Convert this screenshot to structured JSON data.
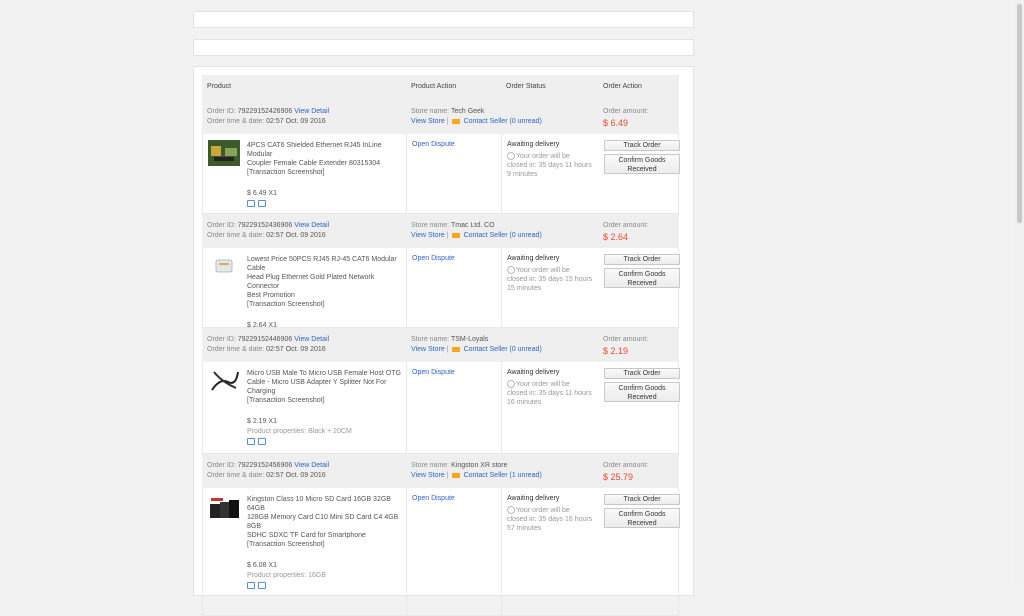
{
  "header": {
    "product": "Product",
    "product_action": "Product Action",
    "order_status": "Order Status",
    "order_action": "Order Action"
  },
  "labels": {
    "order_id": "Order ID:",
    "order_time": "Order time & date:",
    "view_detail": "View Detail",
    "store_name": "Store name:",
    "view_store": "View Store",
    "separator": "|",
    "contact_seller": "Contact Seller",
    "order_amount": "Order amount:",
    "transaction_screenshot": "[Transaction Screenshot]",
    "open_dispute": "Open Dispute",
    "awaiting": "Awaiting delivery",
    "track_order": "Track Order",
    "confirm_line1": "Confirm Goods",
    "confirm_line2": "Received"
  },
  "orders": [
    {
      "id": "79229152426906",
      "time": "02:57 Oct. 09 2016",
      "store": "Tech Geek",
      "unread": "(0 unread)",
      "amount": "$ 6.49",
      "title_1": "4PCS CAT6 Shielded Ethernet RJ45 InLine Modular",
      "title_2": "Coupler Female Cable Extender 80315304",
      "title_3": "",
      "price": "$ 6.49 X1",
      "props": "",
      "close_1": "Your order will be",
      "close_2": "closed in: 35 days 11 hours",
      "close_3": "9 minutes"
    },
    {
      "id": "79229152436906",
      "time": "02:57 Oct. 09 2016",
      "store": "Tmac Ltd. CO",
      "unread": "(0 unread)",
      "amount": "$ 2.64",
      "title_1": "Lowest Price 50PCS RJ45 RJ-45 CAT6 Modular Cable",
      "title_2": "Head Plug Ethernet Gold Plated Network Connector",
      "title_3": "Best Promotion",
      "price": "$ 2.64 X1",
      "props": "",
      "close_1": "Your order will be",
      "close_2": "closed in: 35 days 15 hours",
      "close_3": "15 minutes"
    },
    {
      "id": "79229152446906",
      "time": "02:57 Oct. 09 2016",
      "store": "TSM-Loyals",
      "unread": "(0 unread)",
      "amount": "$ 2.19",
      "title_1": "Micro USB Male To Micro USB Female Host OTG",
      "title_2": "Cable - Micro USB Adapter Y Splitter Not For",
      "title_3": "Charging",
      "price": "$ 2.19 X1",
      "props": "Product properties: Black + 20CM",
      "close_1": "Your order will be",
      "close_2": "closed in: 35 days 11 hours",
      "close_3": "16 minutes"
    },
    {
      "id": "79229152456906",
      "time": "02:57 Oct. 09 2016",
      "store": "Kingston XR store",
      "unread": "(1 unread)",
      "amount": "$ 25.79",
      "title_1": "Kingston Class 10 Micro SD Card 16GB 32GB 64GB",
      "title_2": "128GB Memory Card C10 Mini SD Card C4 4GB 8GB",
      "title_3": "SDHC SDXC TF Card for Smartphone",
      "price": "$ 6.08 X1",
      "props": "Product properties: 16GB",
      "close_1": "Your order will be",
      "close_2": "closed in: 35 days 16 hours",
      "close_3": "57 minutes"
    }
  ]
}
